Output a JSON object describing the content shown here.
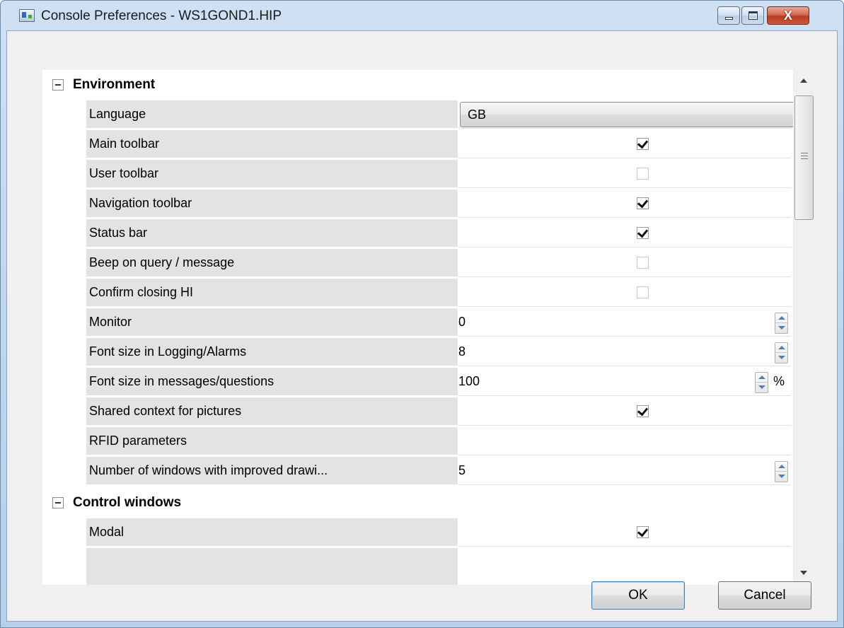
{
  "window": {
    "title": "Console Preferences - WS1GOND1.HIP",
    "controls": {
      "minimize": "",
      "maximize": "",
      "close": "X"
    }
  },
  "categories": [
    {
      "name": "Environment",
      "expanded": true
    },
    {
      "name": "Control windows",
      "expanded": true
    }
  ],
  "environment": {
    "language_label": "Language",
    "language_value": "GB",
    "main_toolbar_label": "Main toolbar",
    "main_toolbar_checked": true,
    "user_toolbar_label": "User toolbar",
    "user_toolbar_checked": false,
    "navigation_toolbar_label": "Navigation toolbar",
    "navigation_toolbar_checked": true,
    "status_bar_label": "Status bar",
    "status_bar_checked": true,
    "beep_label": "Beep on query / message",
    "beep_checked": false,
    "confirm_closing_label": "Confirm closing HI",
    "confirm_closing_checked": false,
    "monitor_label": "Monitor",
    "monitor_value": "0",
    "font_logging_label": "Font size in Logging/Alarms",
    "font_logging_value": "8",
    "font_messages_label": "Font size in messages/questions",
    "font_messages_value": "100",
    "font_messages_unit": "%",
    "shared_context_label": "Shared context for pictures",
    "shared_context_checked": true,
    "rfid_label": "RFID parameters",
    "rfid_value": "",
    "windows_improved_label": "Number of windows with improved drawi...",
    "windows_improved_value": "5"
  },
  "control_windows": {
    "modal_label": "Modal",
    "modal_checked": true
  },
  "buttons": {
    "ok": "OK",
    "cancel": "Cancel"
  }
}
